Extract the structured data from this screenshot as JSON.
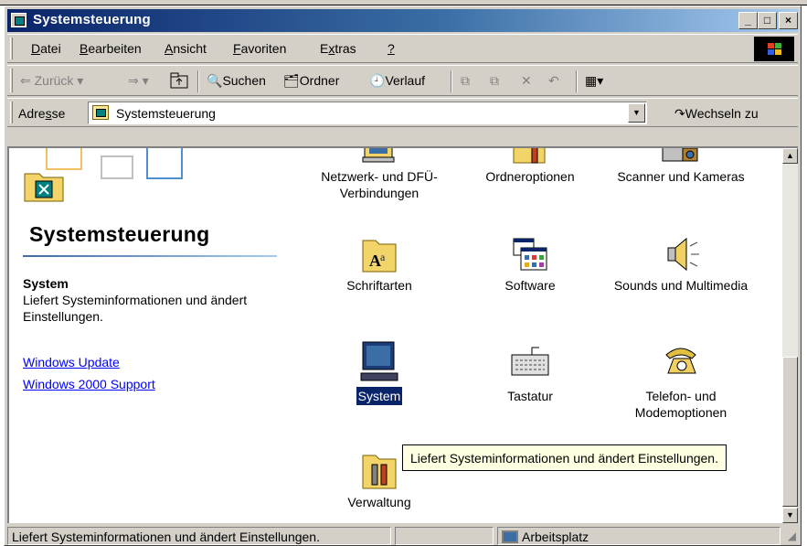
{
  "window": {
    "title": "Systemsteuerung",
    "controls": [
      "_",
      "□",
      "×"
    ]
  },
  "menu": [
    {
      "pre": "",
      "u": "D",
      "post": "atei"
    },
    {
      "pre": "",
      "u": "B",
      "post": "earbeiten"
    },
    {
      "pre": "",
      "u": "A",
      "post": "nsicht"
    },
    {
      "pre": "",
      "u": "F",
      "post": "avoriten"
    },
    {
      "pre": "E",
      "u": "x",
      "post": "tras"
    },
    {
      "pre": "",
      "u": "?",
      "post": ""
    }
  ],
  "toolbar": {
    "back": "Zurück",
    "search": "Suchen",
    "folders": "Ordner",
    "history": "Verlauf"
  },
  "address": {
    "label_pre": "Adre",
    "label_u": "s",
    "label_post": "se",
    "value": "Systemsteuerung",
    "go": "Wechseln zu"
  },
  "panel": {
    "title": "Systemsteuerung",
    "info_title": "System",
    "info_text": "Liefert Systeminformationen und ändert Einstellungen.",
    "links": [
      "Windows Update",
      "Windows 2000 Support"
    ]
  },
  "items": [
    {
      "label": "Netzwerk- und DFÜ-Verbindungen",
      "icon": "network-connections-icon",
      "selected": false
    },
    {
      "label": "Ordneroptionen",
      "icon": "folder-options-icon",
      "selected": false
    },
    {
      "label": "Scanner und Kameras",
      "icon": "scanner-camera-icon",
      "selected": false
    },
    {
      "label": "Schriftarten",
      "icon": "fonts-folder-icon",
      "selected": false
    },
    {
      "label": "Software",
      "icon": "software-icon",
      "selected": false
    },
    {
      "label": "Sounds und Multimedia",
      "icon": "speaker-icon",
      "selected": false
    },
    {
      "label": "System",
      "icon": "computer-icon",
      "selected": true
    },
    {
      "label": "Tastatur",
      "icon": "keyboard-icon",
      "selected": false
    },
    {
      "label": "Telefon- und Modemoptionen",
      "icon": "telephone-icon",
      "selected": false
    },
    {
      "label": "Verwaltung",
      "icon": "admin-tools-icon",
      "selected": false
    }
  ],
  "tooltip": "Liefert Systeminformationen und ändert Einstellungen.",
  "status": {
    "text": "Liefert Systeminformationen und ändert Einstellungen.",
    "zone": "Arbeitsplatz"
  },
  "colors": {
    "titlebar": "#0a246a",
    "selection": "#0a246a",
    "link": "#0000ff",
    "tooltip_bg": "#ffffe1"
  }
}
